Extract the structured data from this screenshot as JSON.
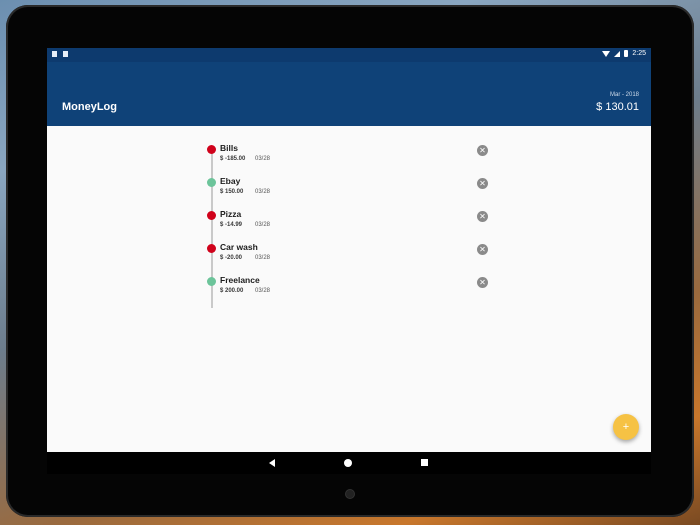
{
  "status_bar": {
    "time": "2:25"
  },
  "app_bar": {
    "title": "MoneyLog",
    "month": "Mar - 2018",
    "balance": "$ 130.01"
  },
  "entries": [
    {
      "name": "Bills",
      "amount": "$ -185.00",
      "date": "03/28",
      "type": "expense"
    },
    {
      "name": "Ebay",
      "amount": "$ 150.00",
      "date": "03/28",
      "type": "income"
    },
    {
      "name": "Pizza",
      "amount": "$ -14.99",
      "date": "03/28",
      "type": "expense"
    },
    {
      "name": "Car wash",
      "amount": "$ -20.00",
      "date": "03/28",
      "type": "expense"
    },
    {
      "name": "Freelance",
      "amount": "$ 200.00",
      "date": "03/28",
      "type": "income"
    }
  ],
  "colors": {
    "expense": "#d0021b",
    "income": "#6cc49a",
    "app_bar": "#0f4278",
    "fab": "#f6c244"
  },
  "icons": {
    "remove": "close-circle-icon",
    "fab": "plus-icon"
  }
}
